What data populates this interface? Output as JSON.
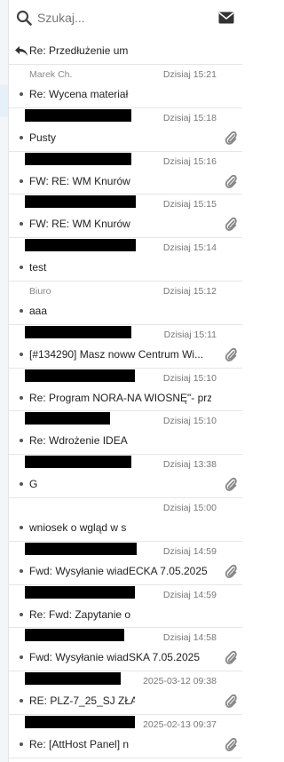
{
  "search": {
    "placeholder": "Szukaj...",
    "icon": "search-icon",
    "compose_icon": "envelope-icon"
  },
  "thread": {
    "icon": "reply-icon",
    "subject": "Re: Przedłużenie um"
  },
  "messages": [
    {
      "from": "Marek Ch.",
      "date": "Dzisiaj 15:21",
      "subject": "Re: Wycena materiał",
      "subject_tail": "",
      "redacted": false,
      "attachment": false
    },
    {
      "from": "",
      "date": "Dzisiaj 15:18",
      "subject": "Pusty",
      "subject_tail": "",
      "redacted": true,
      "attachment": true
    },
    {
      "from": "",
      "date": "Dzisiaj 15:16",
      "subject": "FW: RE: WM Knurów",
      "subject_tail": "",
      "redacted": true,
      "attachment": true
    },
    {
      "from": "",
      "date": "Dzisiaj 15:15",
      "subject": "FW: RE: WM Knurów",
      "subject_tail": "",
      "redacted": true,
      "attachment": true
    },
    {
      "from": "",
      "date": "Dzisiaj 15:14",
      "subject": "test",
      "subject_tail": "",
      "redacted": true,
      "attachment": false
    },
    {
      "from": "Biuro",
      "date": "Dzisiaj 15:12",
      "subject": "aaa",
      "subject_tail": "",
      "redacted": false,
      "attachment": false
    },
    {
      "from": "",
      "date": "Dzisiaj 15:11",
      "subject": "[#134290] Masz now",
      "subject_tail": "w Centrum Wi...",
      "redacted": true,
      "attachment": true
    },
    {
      "from": "",
      "date": "Dzisiaj 15:10",
      "subject": "Re: Program NORA-",
      "subject_tail": "NA WIOSNĘ\"- prz...",
      "redacted": true,
      "attachment": false
    },
    {
      "from": "",
      "date": "Dzisiaj 15:10",
      "subject": "Re: Wdrożenie IDEA",
      "subject_tail": "",
      "redacted": true,
      "attachment": false
    },
    {
      "from": "",
      "date": "Dzisiaj 13:38",
      "subject": "G",
      "subject_tail": "",
      "redacted": true,
      "attachment": true
    },
    {
      "from": "",
      "date": "Dzisiaj 15:00",
      "subject": "wniosek o wgląd w s",
      "subject_tail": "",
      "redacted": true,
      "attachment": false
    },
    {
      "from": "",
      "date": "Dzisiaj 14:59",
      "subject": "Fwd: Wysyłanie wiad",
      "subject_tail": "ECKA 7.05.2025",
      "redacted": true,
      "attachment": true
    },
    {
      "from": "",
      "date": "Dzisiaj 14:59",
      "subject": "Re: Fwd: Zapytanie o",
      "subject_tail": "",
      "redacted": true,
      "attachment": false
    },
    {
      "from": "",
      "date": "Dzisiaj 14:58",
      "subject": "Fwd: Wysyłanie wiad",
      "subject_tail": "SKA 7.05.2025",
      "redacted": true,
      "attachment": true
    },
    {
      "from": "",
      "date": "2025-03-12 09:38",
      "subject": "RE: PLZ-7_25_SJ ZŁA",
      "subject_tail": "",
      "redacted": true,
      "attachment": true
    },
    {
      "from": "",
      "date": "2025-02-13 09:37",
      "subject": "Re: [AttHost Panel] n",
      "subject_tail": "",
      "redacted": true,
      "attachment": true
    }
  ]
}
